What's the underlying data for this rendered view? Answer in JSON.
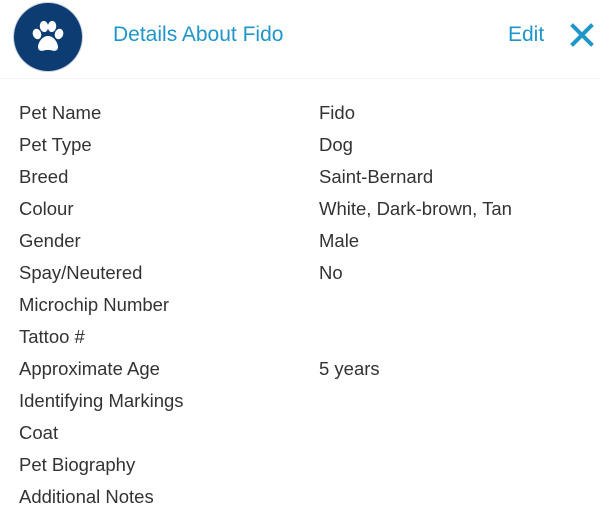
{
  "header": {
    "title": "Details About Fido",
    "edit_label": "Edit",
    "avatar_icon": "paw-icon",
    "close_icon": "close-icon",
    "accent_color": "#1f96c9",
    "avatar_color": "#0d3c73"
  },
  "details": [
    {
      "label": "Pet Name",
      "value": "Fido"
    },
    {
      "label": "Pet Type",
      "value": "Dog"
    },
    {
      "label": "Breed",
      "value": "Saint-Bernard"
    },
    {
      "label": "Colour",
      "value": "White, Dark-brown, Tan"
    },
    {
      "label": "Gender",
      "value": "Male"
    },
    {
      "label": "Spay/Neutered",
      "value": "No"
    },
    {
      "label": "Microchip Number",
      "value": ""
    },
    {
      "label": "Tattoo #",
      "value": ""
    },
    {
      "label": "Approximate Age",
      "value": "5 years"
    },
    {
      "label": "Identifying Markings",
      "value": ""
    },
    {
      "label": "Coat",
      "value": ""
    },
    {
      "label": "Pet Biography",
      "value": ""
    },
    {
      "label": "Additional Notes",
      "value": ""
    }
  ]
}
